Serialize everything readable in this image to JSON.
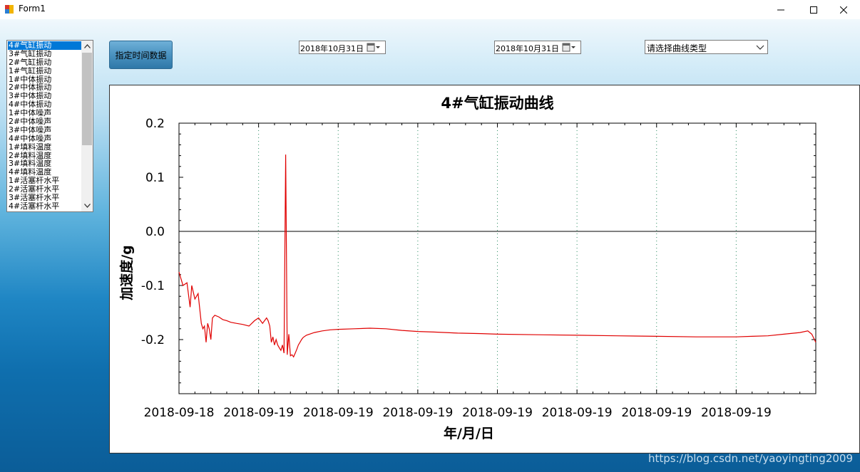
{
  "window": {
    "title": "Form1"
  },
  "list": {
    "items": [
      "4#气缸振动",
      "3#气缸振动",
      "2#气缸振动",
      "1#气缸振动",
      "1#中体振动",
      "2#中体振动",
      "3#中体振动",
      "4#中体振动",
      "1#中体噪声",
      "2#中体噪声",
      "3#中体噪声",
      "4#中体噪声",
      "1#填料温度",
      "2#填料温度",
      "3#填料温度",
      "4#填料温度",
      "1#活塞杆水平",
      "2#活塞杆水平",
      "3#活塞杆水平",
      "4#活塞杆水平"
    ],
    "selected_index": 0
  },
  "toolbar": {
    "fetch_label": "指定时间数据",
    "start_date": "2018年10月31日",
    "end_date": "2018年10月31日",
    "curve_type": "请选择曲线类型"
  },
  "chart_data": {
    "type": "line",
    "title": "4#气缸振动曲线",
    "xlabel": "年/月/日",
    "ylabel": "加速度/g",
    "ylim": [
      -0.3,
      0.2
    ],
    "yticks": [
      "0.2",
      "0.1",
      "0.0",
      "-0.1",
      "-0.2"
    ],
    "ytick_values": [
      0.2,
      0.1,
      0.0,
      -0.1,
      -0.2
    ],
    "xticks": [
      "2018-09-18",
      "2018-09-19",
      "2018-09-19",
      "2018-09-19",
      "2018-09-19",
      "2018-09-19",
      "2018-09-19",
      "2018-09-19"
    ],
    "grid": "vertical dotted",
    "series": [
      {
        "color": "#e00000",
        "x": [
          0.0,
          0.05,
          0.1,
          0.14,
          0.16,
          0.2,
          0.24,
          0.28,
          0.3,
          0.32,
          0.34,
          0.36,
          0.38,
          0.4,
          0.42,
          0.45,
          0.5,
          0.55,
          0.6,
          0.65,
          0.72,
          0.8,
          0.88,
          0.95,
          1.0,
          1.05,
          1.1,
          1.12,
          1.14,
          1.16,
          1.18,
          1.2,
          1.22,
          1.24,
          1.26,
          1.28,
          1.3,
          1.32,
          1.34,
          1.36,
          1.38,
          1.4,
          1.42,
          1.44,
          1.46,
          1.48,
          1.5,
          1.52,
          1.54,
          1.56,
          1.6,
          1.7,
          1.8,
          1.9,
          2.0,
          2.2,
          2.4,
          2.6,
          2.8,
          3.0,
          3.2,
          3.5,
          3.8,
          4.0,
          4.5,
          5.0,
          5.5,
          6.0,
          6.5,
          7.0,
          7.2,
          7.4,
          7.6,
          7.8,
          7.9,
          7.95,
          8.0
        ],
        "y": [
          -0.075,
          -0.1,
          -0.095,
          -0.14,
          -0.1,
          -0.125,
          -0.115,
          -0.17,
          -0.18,
          -0.175,
          -0.205,
          -0.17,
          -0.18,
          -0.2,
          -0.16,
          -0.155,
          -0.158,
          -0.163,
          -0.165,
          -0.168,
          -0.17,
          -0.172,
          -0.175,
          -0.165,
          -0.16,
          -0.17,
          -0.16,
          -0.165,
          -0.175,
          -0.205,
          -0.195,
          -0.21,
          -0.2,
          -0.21,
          -0.215,
          -0.22,
          -0.21,
          -0.225,
          0.142,
          -0.228,
          -0.19,
          -0.23,
          -0.228,
          -0.232,
          -0.225,
          -0.218,
          -0.21,
          -0.205,
          -0.2,
          -0.196,
          -0.192,
          -0.187,
          -0.184,
          -0.182,
          -0.181,
          -0.18,
          -0.179,
          -0.18,
          -0.183,
          -0.185,
          -0.186,
          -0.188,
          -0.189,
          -0.19,
          -0.191,
          -0.192,
          -0.193,
          -0.194,
          -0.195,
          -0.195,
          -0.194,
          -0.193,
          -0.19,
          -0.187,
          -0.184,
          -0.19,
          -0.205
        ]
      }
    ]
  },
  "footer": {
    "watermark": "https://blog.csdn.net/yaoyingting2009"
  }
}
